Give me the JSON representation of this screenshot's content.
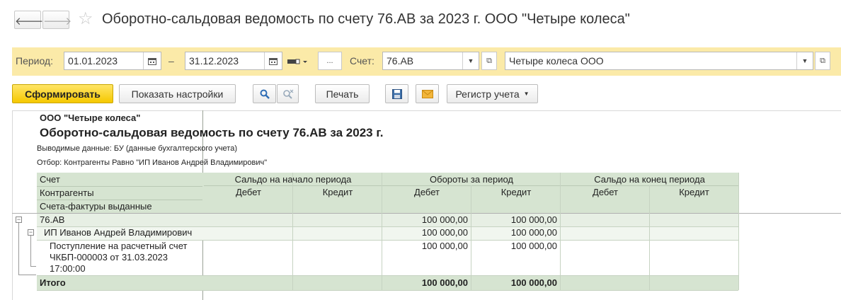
{
  "window": {
    "title": "Оборотно-сальдовая ведомость по счету 76.АВ за 2023 г. ООО \"Четыре колеса\"",
    "back_glyph": "🡐",
    "forward_glyph": "🡒",
    "star_glyph": "☆"
  },
  "filters": {
    "period_label": "Период:",
    "date_from": "01.01.2023",
    "dash": "–",
    "date_to": "31.12.2023",
    "ellipsis": "...",
    "account_label": "Счет:",
    "account": "76.АВ",
    "organization": "Четыре колеса ООО"
  },
  "toolbar": {
    "generate": "Сформировать",
    "show_settings": "Показать настройки",
    "print": "Печать",
    "register": "Регистр учета"
  },
  "report": {
    "org": "ООО \"Четыре колеса\"",
    "title": "Оборотно-сальдовая ведомость по счету 76.АВ за 2023 г.",
    "output_data": "Выводимые данные: БУ (данные бухгалтерского учета)",
    "filter": "Отбор: Контрагенты Равно \"ИП Иванов Андрей Владимирович\"",
    "headers": {
      "account": "Счет",
      "counterparties": "Контрагенты",
      "invoices": "Счета-фактуры выданные",
      "opening": "Сальдо на начало периода",
      "turnover": "Обороты за период",
      "closing": "Сальдо на конец периода",
      "debit": "Дебет",
      "credit": "Кредит"
    },
    "rows": [
      {
        "name": "76.АВ",
        "turnover_debit": "100 000,00",
        "turnover_credit": "100 000,00"
      },
      {
        "name": "ИП Иванов Андрей Владимирович",
        "turnover_debit": "100 000,00",
        "turnover_credit": "100 000,00"
      },
      {
        "line1": "Поступление на расчетный счет",
        "line2": "ЧКБП-000003 от 31.03.2023",
        "line3": "17:00:00",
        "turnover_debit": "100 000,00",
        "turnover_credit": "100 000,00"
      }
    ],
    "total": {
      "label": "Итого",
      "turnover_debit": "100 000,00",
      "turnover_credit": "100 000,00"
    }
  },
  "colors": {
    "header_green": "#d6e4d1",
    "yellow_bar": "#fbeaa8",
    "accent_yellow": "#f5c800"
  }
}
